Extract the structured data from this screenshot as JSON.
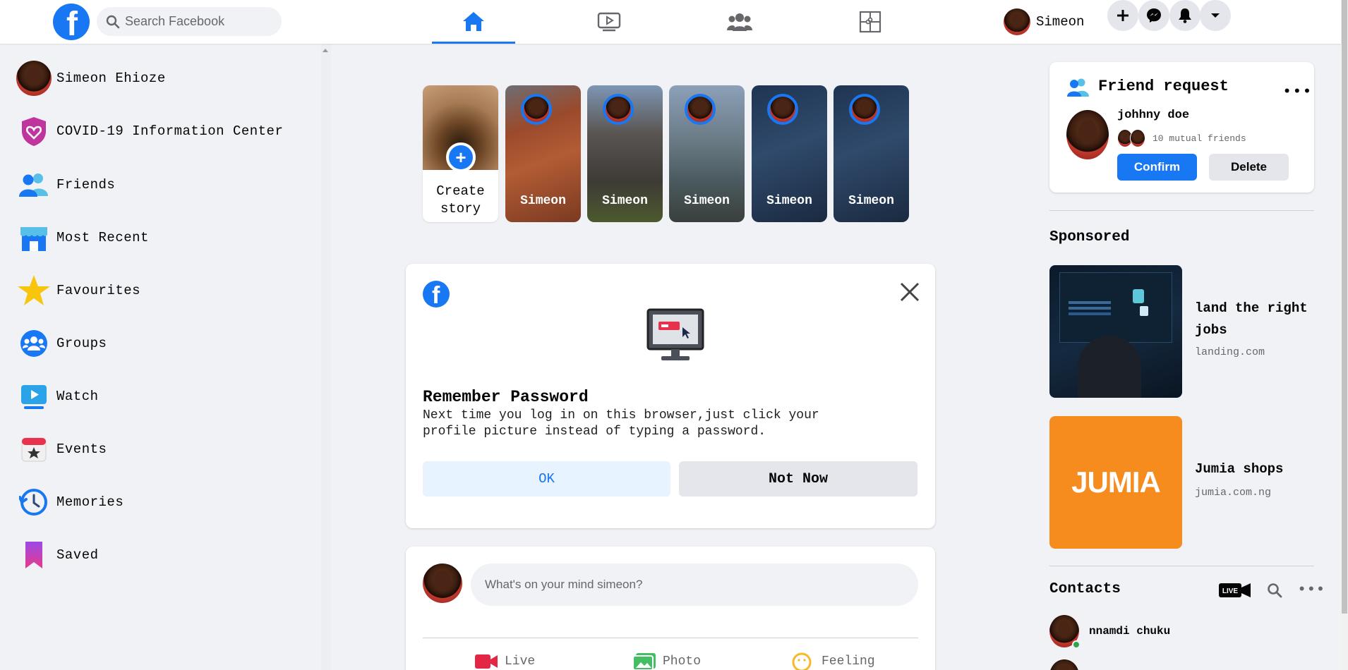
{
  "topbar": {
    "logo_letter": "f",
    "search_placeholder": "Search Facebook",
    "profile_name": "Simeon",
    "nav": [
      "home",
      "watch",
      "groups",
      "gaming"
    ],
    "active_nav": "home"
  },
  "sidebar": {
    "items": [
      {
        "label": "Simeon Ehioze",
        "icon": "profile-avatar"
      },
      {
        "label": "COVID-19 Information Center",
        "icon": "covid-heart-icon"
      },
      {
        "label": "Friends",
        "icon": "friends-icon"
      },
      {
        "label": "Most Recent",
        "icon": "most-recent-icon"
      },
      {
        "label": "Favourites",
        "icon": "star-icon"
      },
      {
        "label": "Groups",
        "icon": "groups-icon"
      },
      {
        "label": "Watch",
        "icon": "watch-icon"
      },
      {
        "label": "Events",
        "icon": "events-icon"
      },
      {
        "label": "Memories",
        "icon": "memories-icon"
      },
      {
        "label": "Saved",
        "icon": "saved-icon"
      }
    ]
  },
  "stories": {
    "create_label_1": "Create",
    "create_label_2": "story",
    "items": [
      {
        "name": "Simeon"
      },
      {
        "name": "Simeon"
      },
      {
        "name": "Simeon"
      },
      {
        "name": "Simeon"
      },
      {
        "name": "Simeon"
      }
    ]
  },
  "password_dialog": {
    "logo_letter": "f",
    "title": "Remember Password",
    "line1": "Next time you log in on this browser,just click your",
    "line2": "profile picture instead of typing a password.",
    "ok_label": "OK",
    "not_now_label": "Not Now"
  },
  "composer": {
    "placeholder": "What's on your mind simeon?",
    "actions": [
      "Live",
      "Photo",
      "Feeling"
    ]
  },
  "friend_request": {
    "title": "Friend request",
    "more": "•••",
    "name": "johhny doe",
    "mutual": "10 mutual friends",
    "confirm_label": "Confirm",
    "delete_label": "Delete"
  },
  "sponsored": {
    "title": "Sponsored",
    "ads": [
      {
        "title_1": "land the right",
        "title_2": "jobs",
        "url": "landing.com"
      },
      {
        "title_1": "Jumia shops",
        "title_2": "",
        "url": "jumia.com.ng",
        "brand": "JUMIA"
      }
    ]
  },
  "contacts": {
    "title": "Contacts",
    "live_label": "LIVE",
    "more": "•••",
    "items": [
      {
        "name": "nnamdi chuku",
        "online": true
      }
    ]
  },
  "colors": {
    "brand": "#1877f2",
    "background": "#f0f2f5",
    "jumia": "#f68b1e",
    "online": "#31a24c"
  }
}
